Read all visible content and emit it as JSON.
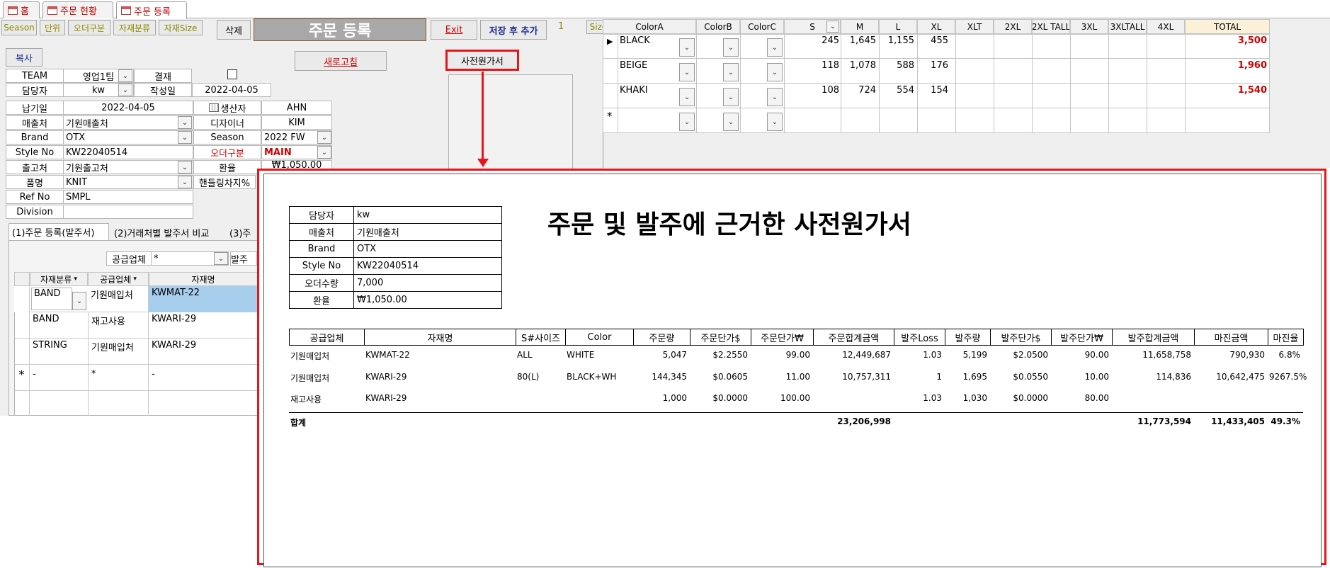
{
  "tabs": [
    {
      "label": "홈"
    },
    {
      "label": "주문 현황"
    },
    {
      "label": "주문 등록"
    }
  ],
  "toolbar": {
    "season": "Season",
    "unit": "단위",
    "order_type": "오더구분",
    "material_cat": "자재분류",
    "material_size": "자재Size",
    "delete": "삭제",
    "form_title": "주문 등록",
    "exit": "Exit",
    "save_add": "저장 후 추가",
    "count": "1",
    "size": "Size"
  },
  "copy_button": "복사",
  "refresh_button": "새로고침",
  "precost_button": "사전원가서",
  "header_form": {
    "team_label": "TEAM",
    "team_value": "영업1팀",
    "approval_label": "결재",
    "manager_label": "담당자",
    "manager_value": "kw",
    "created_label": "작성일",
    "created_value": "2022-04-05",
    "delivery_label": "납기일",
    "delivery_value": "2022-04-05",
    "producer_label": "생산자",
    "producer_value": "AHN",
    "sales_label": "매출처",
    "sales_value": "기원매출처",
    "designer_label": "디자이너",
    "designer_value": "KIM",
    "brand_label": "Brand",
    "brand_value": "OTX",
    "season_label": "Season",
    "season_value": "2022 FW",
    "style_label": "Style No",
    "style_value": "KW22040514",
    "ordertype_label": "오더구분",
    "ordertype_value": "MAIN",
    "shipper_label": "출고처",
    "shipper_value": "기원출고처",
    "fx_label": "환율",
    "fx_value": "₩1,050.00",
    "item_label": "품명",
    "item_value": "KNIT",
    "handling_label": "핸들링차지%",
    "ref_label": "Ref No",
    "ref_value": "SMPL",
    "division_label": "Division",
    "division_value": ""
  },
  "subtabs": [
    {
      "label": "(1)주문 등록(발주서)"
    },
    {
      "label": "(2)거래처별 발주서 비교"
    },
    {
      "label": "(3)주"
    }
  ],
  "supplier_filter": {
    "label": "공급업체",
    "value": "*",
    "next_label": "발주"
  },
  "material_grid": {
    "headers": [
      "자재분류",
      "공급업체",
      "자재명"
    ],
    "rows": [
      {
        "cat": "BAND",
        "supplier": "기원매입처",
        "name": "KWMAT-22"
      },
      {
        "cat": "BAND",
        "supplier": "재고사용",
        "name": "KWARI-29"
      },
      {
        "cat": "STRING",
        "supplier": "기원매입처",
        "name": "KWARI-29"
      },
      {
        "cat": "-",
        "supplier": "*",
        "name": "-"
      }
    ],
    "new_marker": "*"
  },
  "size_grid": {
    "headers": [
      "ColorA",
      "ColorB",
      "ColorC",
      "S",
      "M",
      "L",
      "XL",
      "XLT",
      "2XL",
      "2XL TALL",
      "3XL",
      "3XLTALL",
      "4XL",
      "TOTAL"
    ],
    "rows": [
      {
        "color": "BLACK",
        "s": "245",
        "m": "1,645",
        "l": "1,155",
        "xl": "455",
        "total": "3,500"
      },
      {
        "color": "BEIGE",
        "s": "118",
        "m": "1,078",
        "l": "588",
        "xl": "176",
        "total": "1,960"
      },
      {
        "color": "KHAKI",
        "s": "108",
        "m": "724",
        "l": "554",
        "xl": "154",
        "total": "1,540"
      }
    ],
    "new_marker": "*"
  },
  "report": {
    "title": "주문 및 발주에 근거한 사전원가서",
    "info": [
      {
        "k": "담당자",
        "v": "kw"
      },
      {
        "k": "매출처",
        "v": "기원매출처"
      },
      {
        "k": "Brand",
        "v": "OTX"
      },
      {
        "k": "Style No",
        "v": "KW22040514"
      },
      {
        "k": "오더수량",
        "v": "7,000"
      },
      {
        "k": "환율",
        "v": "₩1,050.00"
      }
    ],
    "headers": [
      "공급업체",
      "자재명",
      "S#사이즈",
      "Color",
      "주문량",
      "주문단가$",
      "주문단가₩",
      "주문합계금액",
      "발주Loss",
      "발주량",
      "발주단가$",
      "발주단가₩",
      "발주합계금액",
      "마진금액",
      "마진율"
    ],
    "rows": [
      [
        "기원매입처",
        "KWMAT-22",
        "ALL",
        "WHITE",
        "5,047",
        "$2.2550",
        "99.00",
        "12,449,687",
        "1.03",
        "5,199",
        "$2.0500",
        "90.00",
        "11,658,758",
        "790,930",
        "6.8%"
      ],
      [
        "기원매입처",
        "KWARI-29",
        "80(L)",
        "BLACK+WH",
        "144,345",
        "$0.0605",
        "11.00",
        "10,757,311",
        "1",
        "1,695",
        "$0.0550",
        "10.00",
        "114,836",
        "10,642,475",
        "9267.5%"
      ],
      [
        "재고사용",
        "KWARI-29",
        "",
        "",
        "1,000",
        "$0.0000",
        "100.00",
        "",
        "1.03",
        "1,030",
        "$0.0000",
        "80.00",
        "",
        "",
        ""
      ]
    ],
    "total_label": "합계",
    "total_order_sum": "23,206,998",
    "total_po_sum": "11,773,594",
    "total_margin": "11,433,405",
    "total_margin_rate": "49.3%"
  },
  "colors": {
    "accent_red": "#e8141c",
    "title_bar": "#a8a8a8"
  }
}
